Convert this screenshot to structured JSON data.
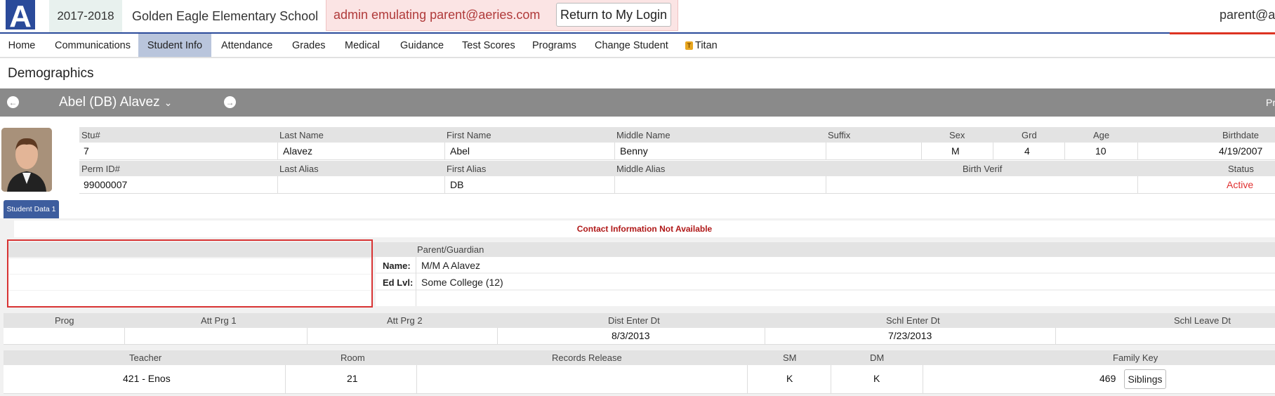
{
  "header": {
    "school_year": "2017-2018",
    "school_name": "Golden Eagle Elementary School",
    "emulating_text": "admin emulating parent@aeries.com",
    "return_button": "Return to My Login",
    "user": "parent@aeries.com",
    "logo_letter": "A"
  },
  "nav": {
    "items": [
      "Home",
      "Communications",
      "Student Info",
      "Attendance",
      "Grades",
      "Medical",
      "Guidance",
      "Test Scores",
      "Programs",
      "Change Student",
      "Titan"
    ],
    "active": "Student Info"
  },
  "page": {
    "title": "Demographics"
  },
  "student_bar": {
    "name": "Abel (DB) Alavez",
    "right_text": "Pr"
  },
  "demographics": {
    "labels1": {
      "stu": "Stu#",
      "last": "Last Name",
      "first": "First Name",
      "middle": "Middle Name",
      "suffix": "Suffix",
      "sex": "Sex",
      "grd": "Grd",
      "age": "Age",
      "birthdate": "Birthdate"
    },
    "values1": {
      "stu": "7",
      "last": "Alavez",
      "first": "Abel",
      "middle": "Benny",
      "suffix": "",
      "sex": "M",
      "grd": "4",
      "age": "10",
      "birthdate": "4/19/2007"
    },
    "labels2": {
      "perm": "Perm ID#",
      "last_alias": "Last Alias",
      "first_alias": "First Alias",
      "middle_alias": "Middle Alias",
      "birth_verif": "Birth Verif",
      "status": "Status"
    },
    "values2": {
      "perm": "99000007",
      "last_alias": "",
      "first_alias": "DB",
      "middle_alias": "",
      "birth_verif": "",
      "status": "Active"
    }
  },
  "tabs": {
    "student_data_1": "Student Data 1"
  },
  "contact": {
    "not_available": "Contact Information Not Available"
  },
  "guardian": {
    "header": "Parent/Guardian",
    "name_label": "Name:",
    "name_value": "M/M A Alavez",
    "edlvl_label": "Ed Lvl:",
    "edlvl_value": "Some College (12)"
  },
  "enrollment": {
    "labels": {
      "prog": "Prog",
      "att1": "Att Prg 1",
      "att2": "Att Prg 2",
      "dist": "Dist Enter Dt",
      "schl_enter": "Schl Enter Dt",
      "schl_leave": "Schl Leave Dt"
    },
    "values": {
      "prog": "",
      "att1": "",
      "att2": "",
      "dist": "8/3/2013",
      "schl_enter": "7/23/2013",
      "schl_leave": ""
    }
  },
  "teacher": {
    "labels": {
      "teacher": "Teacher",
      "room": "Room",
      "records": "Records Release",
      "sm": "SM",
      "dm": "DM",
      "family": "Family Key"
    },
    "values": {
      "teacher": "421 - Enos",
      "room": "21",
      "records": "",
      "sm": "K",
      "dm": "K",
      "family": "469"
    },
    "siblings_button": "Siblings"
  },
  "colors": {
    "accent_blue": "#3d5d9e",
    "bar_gray": "#8a8a8a",
    "status_active": "#e03030",
    "alert_red": "#b01818"
  }
}
